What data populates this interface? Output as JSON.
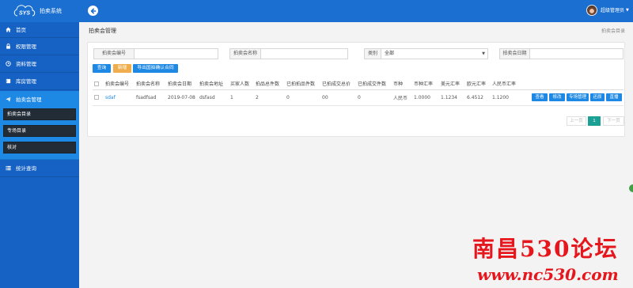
{
  "app": {
    "title": "拍卖系统",
    "logo_text": "SYS"
  },
  "colors": {
    "header": "#1a6fd0",
    "sidebar": "#1662c4",
    "sidebar_active": "#1e88e5",
    "submenu": "#222c37",
    "primary": "#1e88e5",
    "warning": "#f0ad4e",
    "page_active": "#1aa094",
    "watermark": "#e5161c"
  },
  "sidebar": {
    "items": [
      {
        "label": "首页",
        "icon": "home-icon"
      },
      {
        "label": "权限管理",
        "icon": "lock-icon"
      },
      {
        "label": "资料管理",
        "icon": "clock-icon"
      },
      {
        "label": "库房管理",
        "icon": "book-icon"
      },
      {
        "label": "拍卖会管理",
        "icon": "send-icon",
        "expanded": true,
        "children": [
          {
            "label": "拍卖会目录",
            "active": true
          },
          {
            "label": "专场目录"
          },
          {
            "label": "核对"
          }
        ]
      },
      {
        "label": "统计查询",
        "icon": "list-icon"
      }
    ]
  },
  "header": {
    "back_icon": "back-arrow-icon",
    "user_name": "超级管理员",
    "user_menu_icon": "caret-down-icon"
  },
  "breadcrumb": {
    "section": "拍卖会管理",
    "current": "拍卖会目录"
  },
  "search": {
    "auction_no": {
      "label": "拍卖会编号",
      "value": ""
    },
    "auction_name": {
      "label": "拍卖会名称",
      "value": ""
    },
    "category": {
      "label": "类别",
      "selected": "全部"
    },
    "auction_date": {
      "label": "拍卖会日期",
      "value": ""
    }
  },
  "toolbar": {
    "query_label": "查询",
    "add_label": "新增",
    "export_label": "导出国拍确认合同"
  },
  "table": {
    "columns": [
      "拍卖会编号",
      "拍卖会名称",
      "拍卖会日期",
      "拍卖会地址",
      "买家人数",
      "拍品总件数",
      "已拍拍品件数",
      "已拍成交总价",
      "已拍成交件数",
      "币种",
      "币种汇率",
      "美元汇率",
      "欧元汇率",
      "人民币汇率"
    ],
    "rows": [
      {
        "checked": false,
        "cells": [
          "sdaf",
          "fsadfsad",
          "2019-07-08",
          "dsfasd",
          "1",
          "2",
          "0",
          "00",
          "0",
          "人民币",
          "1.0000",
          "1.1234",
          "6.4512",
          "1.1200"
        ]
      }
    ],
    "row_actions": [
      "查看",
      "修改",
      "专场管理",
      "还原",
      "直播"
    ]
  },
  "pagination": {
    "prev_label": "上一页",
    "current_page": "1",
    "next_label": "下一页"
  },
  "watermark": {
    "line1": "南昌530论坛",
    "line2": "www.nc530.com"
  }
}
